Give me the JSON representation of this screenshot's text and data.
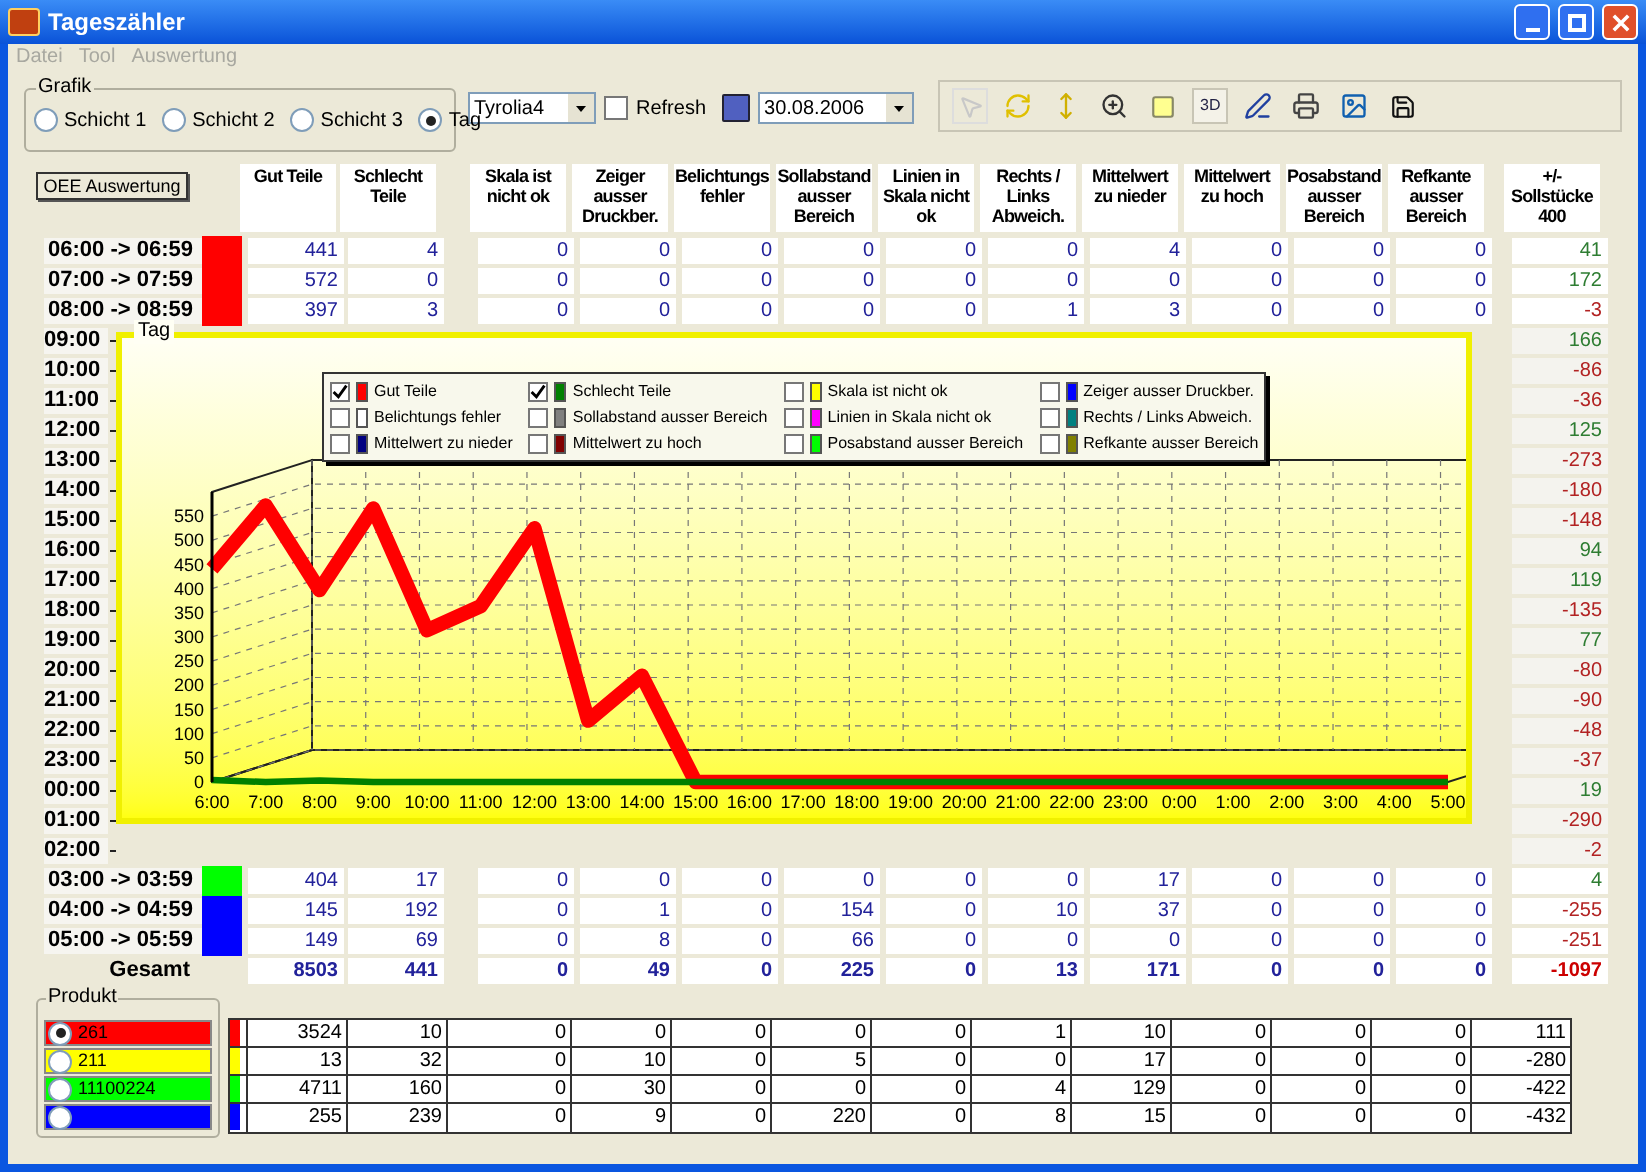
{
  "window": {
    "title": "Tageszähler"
  },
  "menu": [
    "Datei",
    "Tool",
    "Auswertung"
  ],
  "grafik": {
    "label": "Grafik",
    "options": [
      {
        "label": "Schicht 1",
        "selected": false
      },
      {
        "label": "Schicht 2",
        "selected": false
      },
      {
        "label": "Schicht 3",
        "selected": false
      },
      {
        "label": "Tag",
        "selected": true
      }
    ]
  },
  "machine": {
    "value": "Tyrolia4"
  },
  "refresh": {
    "label": "Refresh",
    "checked": false
  },
  "date": {
    "value": "30.08.2006"
  },
  "toolbar": {
    "three_d_label": "3D"
  },
  "oee_button": "OEE Auswertung",
  "columns": [
    "Gut Teile",
    "Schlecht Teile",
    "Skala ist nicht ok",
    "Zeiger ausser Druckber.",
    "Belichtungs fehler",
    "Sollabstand ausser Bereich",
    "Linien in Skala nicht ok",
    "Rechts / Links Abweich.",
    "Mittelwert zu nieder",
    "Mittelwert zu hoch",
    "Posabstand ausser Bereich",
    "Refkante ausser Bereich",
    "+/- Sollstücke 400"
  ],
  "rows_top": [
    {
      "time": "06:00 -> 06:59",
      "color": "#ff0000",
      "values": [
        "441",
        "4",
        "0",
        "0",
        "0",
        "0",
        "0",
        "0",
        "4",
        "0",
        "0",
        "0"
      ],
      "balance": {
        "text": "41",
        "color": "#2e7d32"
      }
    },
    {
      "time": "07:00 -> 07:59",
      "color": "#ff0000",
      "values": [
        "572",
        "0",
        "0",
        "0",
        "0",
        "0",
        "0",
        "0",
        "0",
        "0",
        "0",
        "0"
      ],
      "balance": {
        "text": "172",
        "color": "#2e7d32"
      }
    },
    {
      "time": "08:00 -> 08:59",
      "color": "#ff0000",
      "values": [
        "397",
        "3",
        "0",
        "0",
        "0",
        "0",
        "0",
        "1",
        "3",
        "0",
        "0",
        "0"
      ],
      "balance": {
        "text": "-3",
        "color": "#b22222"
      }
    }
  ],
  "rows_hidden": [
    {
      "time": "09:00",
      "balance": {
        "text": "166",
        "color": "#2e7d32"
      }
    },
    {
      "time": "10:00",
      "balance": {
        "text": "-86",
        "color": "#b22222"
      }
    },
    {
      "time": "11:00",
      "balance": {
        "text": "-36",
        "color": "#b22222"
      }
    },
    {
      "time": "12:00",
      "balance": {
        "text": "125",
        "color": "#2e7d32"
      }
    },
    {
      "time": "13:00",
      "balance": {
        "text": "-273",
        "color": "#b22222"
      }
    },
    {
      "time": "14:00",
      "balance": {
        "text": "-180",
        "color": "#b22222"
      }
    },
    {
      "time": "15:00",
      "balance": {
        "text": "-148",
        "color": "#b22222"
      }
    },
    {
      "time": "16:00",
      "balance": {
        "text": "94",
        "color": "#2e7d32"
      }
    },
    {
      "time": "17:00",
      "balance": {
        "text": "119",
        "color": "#2e7d32"
      }
    },
    {
      "time": "18:00",
      "balance": {
        "text": "-135",
        "color": "#b22222"
      }
    },
    {
      "time": "19:00",
      "balance": {
        "text": "77",
        "color": "#2e7d32"
      }
    },
    {
      "time": "20:00",
      "balance": {
        "text": "-80",
        "color": "#b22222"
      }
    },
    {
      "time": "21:00",
      "balance": {
        "text": "-90",
        "color": "#b22222"
      }
    },
    {
      "time": "22:00",
      "balance": {
        "text": "-48",
        "color": "#b22222"
      }
    },
    {
      "time": "23:00",
      "balance": {
        "text": "-37",
        "color": "#b22222"
      }
    },
    {
      "time": "00:00",
      "balance": {
        "text": "19",
        "color": "#2e7d32"
      }
    },
    {
      "time": "01:00",
      "balance": {
        "text": "-290",
        "color": "#b22222"
      }
    },
    {
      "time": "02:00",
      "balance": {
        "text": "-2",
        "color": "#b22222"
      }
    }
  ],
  "rows_bottom": [
    {
      "time": "03:00 -> 03:59",
      "color": "#00ff00",
      "values": [
        "404",
        "17",
        "0",
        "0",
        "0",
        "0",
        "0",
        "0",
        "17",
        "0",
        "0",
        "0"
      ],
      "balance": {
        "text": "4",
        "color": "#2e7d32"
      }
    },
    {
      "time": "04:00 -> 04:59",
      "color": "#0000ff",
      "values": [
        "145",
        "192",
        "0",
        "1",
        "0",
        "154",
        "0",
        "10",
        "37",
        "0",
        "0",
        "0"
      ],
      "balance": {
        "text": "-255",
        "color": "#b22222"
      }
    },
    {
      "time": "05:00 -> 05:59",
      "color": "#0000ff",
      "values": [
        "149",
        "69",
        "0",
        "8",
        "0",
        "66",
        "0",
        "0",
        "0",
        "0",
        "0",
        "0"
      ],
      "balance": {
        "text": "-251",
        "color": "#b22222"
      }
    }
  ],
  "totals": {
    "label": "Gesamt",
    "values": [
      "8503",
      "441",
      "0",
      "49",
      "0",
      "225",
      "0",
      "13",
      "171",
      "0",
      "0",
      "0"
    ],
    "balance": {
      "text": "-1097",
      "color": "#cc0000"
    }
  },
  "chart": {
    "title": "Tag",
    "legend": [
      {
        "checked": true,
        "color": "#ff0000"
      },
      {
        "checked": true,
        "color": "#008000"
      },
      {
        "label": "Skala ist nicht ok",
        "checked": false,
        "color": "#ffff00"
      },
      {
        "label": "Zeiger ausser Druckber.",
        "checked": false,
        "color": "#0000ff"
      },
      {
        "label": "Belichtungs fehler",
        "checked": false,
        "color": "#ffffff"
      },
      {
        "label": "Sollabstand ausser Bereich",
        "checked": false,
        "color": "#808080"
      },
      {
        "label": "Linien in Skala nicht ok",
        "checked": false,
        "color": "#ff00ff"
      },
      {
        "label": "Rechts / Links Abweich.",
        "checked": false,
        "color": "#008080"
      },
      {
        "label": "Mittelwert zu nieder",
        "checked": false,
        "color": "#000080"
      },
      {
        "label": "Mittelwert zu hoch",
        "checked": false,
        "color": "#800000"
      },
      {
        "label": "Posabstand ausser Bereich",
        "checked": false,
        "color": "#00ff00"
      },
      {
        "label": "Refkante ausser Bereich",
        "checked": false,
        "color": "#808000"
      }
    ],
    "chart_data": {
      "type": "line",
      "categories": [
        "6:00",
        "7:00",
        "8:00",
        "9:00",
        "10:00",
        "11:00",
        "12:00",
        "13:00",
        "14:00",
        "15:00",
        "16:00",
        "17:00",
        "18:00",
        "19:00",
        "20:00",
        "21:00",
        "22:00",
        "23:00",
        "0:00",
        "1:00",
        "2:00",
        "3:00",
        "4:00",
        "5:00"
      ],
      "series": [
        {
          "name": "Gut Teile",
          "color": "#ff0000",
          "values": [
            441,
            572,
            397,
            566,
            314,
            364,
            525,
            127,
            220,
            0,
            0,
            0,
            0,
            0,
            0,
            0,
            0,
            0,
            0,
            0,
            0,
            0,
            0,
            0
          ]
        },
        {
          "name": "Schlecht Teile",
          "color": "#008000",
          "values": [
            4,
            0,
            3,
            0,
            0,
            0,
            0,
            0,
            0,
            0,
            0,
            0,
            0,
            0,
            0,
            0,
            0,
            0,
            0,
            0,
            0,
            0,
            0,
            0
          ]
        }
      ],
      "ylim": [
        0,
        600
      ],
      "grid": true,
      "yticks": [
        0,
        50,
        100,
        150,
        200,
        250,
        300,
        350,
        400,
        450,
        500,
        550
      ]
    }
  },
  "products": {
    "label": "Produkt",
    "items": [
      {
        "label": "261",
        "selected": true,
        "color": "#ff0000",
        "values": [
          "3524",
          "10",
          "0",
          "0",
          "0",
          "0",
          "0",
          "1",
          "10",
          "0",
          "0",
          "0",
          "111"
        ]
      },
      {
        "label": "211",
        "selected": false,
        "color": "#ffff00",
        "values": [
          "13",
          "32",
          "0",
          "10",
          "0",
          "5",
          "0",
          "0",
          "17",
          "0",
          "0",
          "0",
          "-280"
        ]
      },
      {
        "label": "11100224",
        "selected": false,
        "color": "#00ff00",
        "values": [
          "4711",
          "160",
          "0",
          "30",
          "0",
          "0",
          "0",
          "4",
          "129",
          "0",
          "0",
          "0",
          "-422"
        ]
      },
      {
        "selected": false,
        "color": "#0000ff",
        "values": [
          "255",
          "239",
          "0",
          "9",
          "0",
          "220",
          "0",
          "8",
          "15",
          "0",
          "0",
          "0",
          "-432"
        ]
      }
    ]
  }
}
